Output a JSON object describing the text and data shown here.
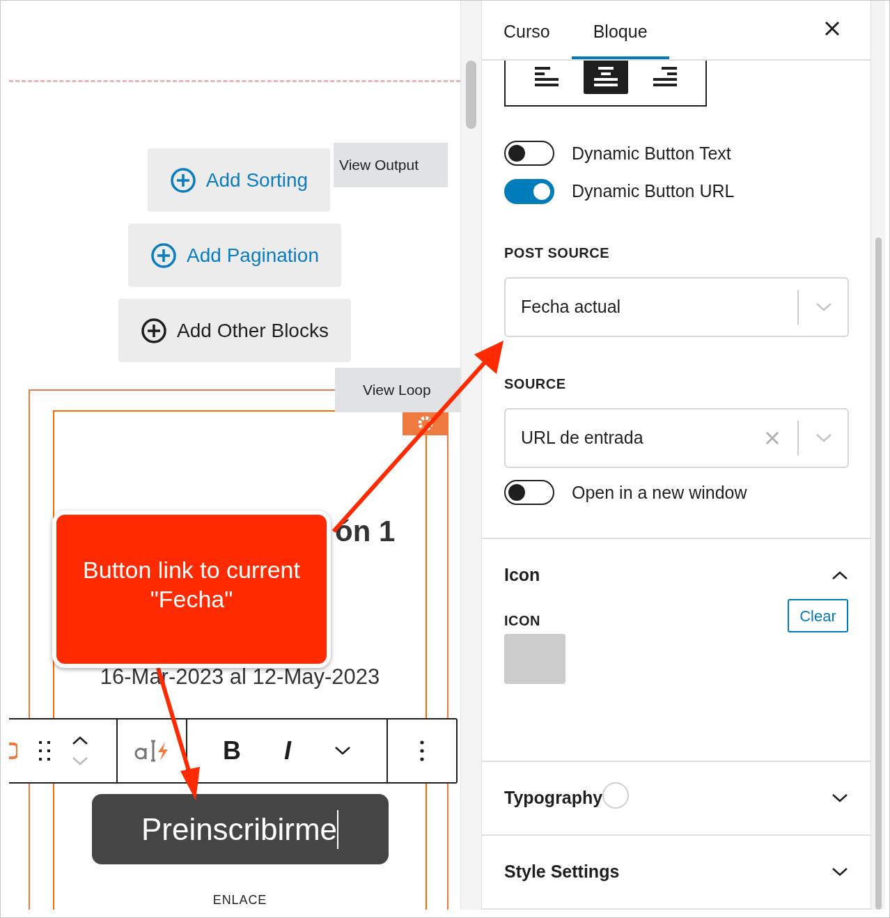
{
  "canvas": {
    "view_output_tab": "View Output",
    "actions": [
      {
        "label": "Add Sorting",
        "kind": "primary"
      },
      {
        "label": "Add Pagination",
        "kind": "primary"
      },
      {
        "label": "Add Other Blocks",
        "kind": "plain"
      }
    ],
    "view_loop_tab": "View Loop",
    "heading_fragment": "ón 1",
    "date_range": "16-Mar-2023 al 12-May-2023",
    "toolbar": {
      "bold": "B",
      "italic": "I"
    },
    "button_text": "Preinscribirme",
    "caption": "ENLACE"
  },
  "annotation": {
    "text": "Button link to current \"Fecha\""
  },
  "sidebar": {
    "tabs": [
      {
        "label": "Curso",
        "selected": false
      },
      {
        "label": "Bloque",
        "selected": true
      }
    ],
    "alignment": [
      {
        "kind": "left",
        "selected": false
      },
      {
        "kind": "center",
        "selected": true
      },
      {
        "kind": "right",
        "selected": false
      }
    ],
    "toggles": [
      {
        "label": "Dynamic Button Text",
        "on": false
      },
      {
        "label": "Dynamic Button URL",
        "on": true
      }
    ],
    "post_source": {
      "label": "POST SOURCE",
      "value": "Fecha actual",
      "clearable": false
    },
    "source": {
      "label": "SOURCE",
      "value": "URL de entrada",
      "clearable": true
    },
    "new_window": {
      "label": "Open in a new window",
      "on": false
    },
    "panels": [
      {
        "title": "Icon",
        "expanded": true,
        "indicator": false
      },
      {
        "title": "Typography",
        "expanded": false,
        "indicator": true
      },
      {
        "title": "Style Settings",
        "expanded": false,
        "indicator": false
      }
    ],
    "icon_field": {
      "label": "ICON",
      "clear": "Clear"
    }
  }
}
